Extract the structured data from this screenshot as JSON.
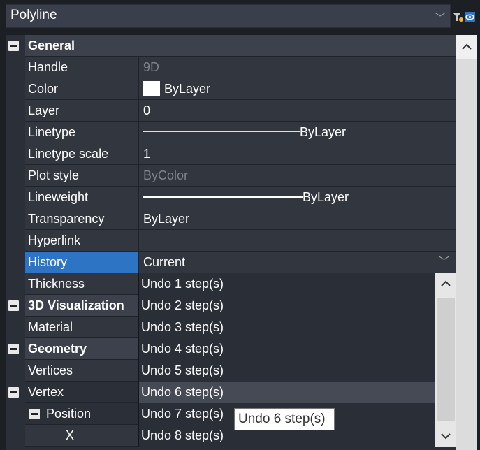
{
  "header": {
    "object_type": "Polyline"
  },
  "properties": {
    "general": {
      "title": "General",
      "rows": {
        "handle": {
          "label": "Handle",
          "value": "9D"
        },
        "color": {
          "label": "Color",
          "value": "ByLayer"
        },
        "layer": {
          "label": "Layer",
          "value": "0"
        },
        "linetype": {
          "label": "Linetype",
          "value": "ByLayer"
        },
        "linetype_scale": {
          "label": "Linetype scale",
          "value": "1"
        },
        "plot_style": {
          "label": "Plot style",
          "value": "ByColor"
        },
        "lineweight": {
          "label": "Lineweight",
          "value": "ByLayer"
        },
        "transparency": {
          "label": "Transparency",
          "value": "ByLayer"
        },
        "hyperlink": {
          "label": "Hyperlink",
          "value": ""
        },
        "history": {
          "label": "History",
          "value": "Current"
        },
        "thickness": {
          "label": "Thickness",
          "value": ""
        }
      }
    },
    "visualization": {
      "title": "3D Visualization",
      "material_label": "Material"
    },
    "geometry": {
      "title": "Geometry",
      "vertices_label": "Vertices",
      "vertex_label": "Vertex",
      "position_label": "Position",
      "x_label": "X"
    }
  },
  "history_dropdown": {
    "options": [
      "Undo 1 step(s)",
      "Undo 2 step(s)",
      "Undo 3 step(s)",
      "Undo 4 step(s)",
      "Undo 5 step(s)",
      "Undo 6 step(s)",
      "Undo 7 step(s)",
      "Undo 8 step(s)"
    ],
    "highlighted_index": 5,
    "tooltip": "Undo 6 step(s)"
  },
  "icons": {
    "topbar_chevron": "chevron-down-icon",
    "quick_select": "filter-icon",
    "toggle_pickadd": "eye-icon",
    "scroll_up": "chevron-up-icon",
    "scroll_down": "chevron-down-icon",
    "collapse": "minus-box-icon"
  },
  "colors": {
    "selection": "#2e74c4",
    "panel": "#32363f",
    "category": "#3c414c"
  }
}
